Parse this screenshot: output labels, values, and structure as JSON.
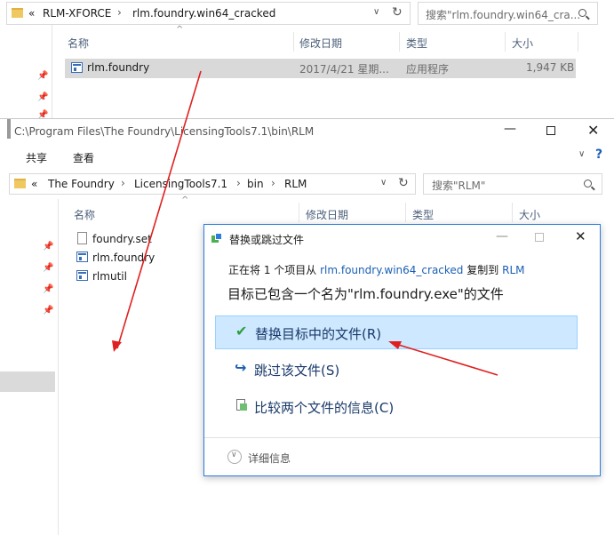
{
  "back_window": {
    "address": {
      "chevrons": "«",
      "path": [
        "RLM-XFORCE",
        "rlm.foundry.win64_cracked"
      ]
    },
    "search_placeholder": "搜索\"rlm.foundry.win64_cra...",
    "columns": {
      "name": "名称",
      "date": "修改日期",
      "type": "类型",
      "size": "大小"
    },
    "file": {
      "name": "rlm.foundry",
      "date": "2017/4/21 星期...",
      "type": "应用程序",
      "size": "1,947 KB"
    }
  },
  "front_window": {
    "title": "C:\\Program Files\\The Foundry\\LicensingTools7.1\\bin\\RLM",
    "ribbon": {
      "share": "共享",
      "view": "查看"
    },
    "address": {
      "chevrons": "«",
      "path": [
        "The Foundry",
        "LicensingTools7.1",
        "bin",
        "RLM"
      ]
    },
    "search_placeholder": "搜索\"RLM\"",
    "columns": {
      "name": "名称",
      "date": "修改日期",
      "type": "类型",
      "size": "大小"
    },
    "files": [
      "foundry.set",
      "rlm.foundry",
      "rlmutil"
    ]
  },
  "dialog": {
    "title": "替换或跳过文件",
    "info_prefix": "正在将 1 个项目从",
    "info_source": "rlm.foundry.win64_cracked",
    "info_mid": "复制到",
    "info_dest": "RLM",
    "heading": "目标已包含一个名为\"rlm.foundry.exe\"的文件",
    "options": {
      "replace": "替换目标中的文件(R)",
      "skip": "跳过该文件(S)",
      "compare": "比较两个文件的信息(C)"
    },
    "details": "详细信息"
  },
  "colors": {
    "accent": "#2b7de0",
    "selection": "#cde8ff",
    "arrow": "#e02020"
  }
}
